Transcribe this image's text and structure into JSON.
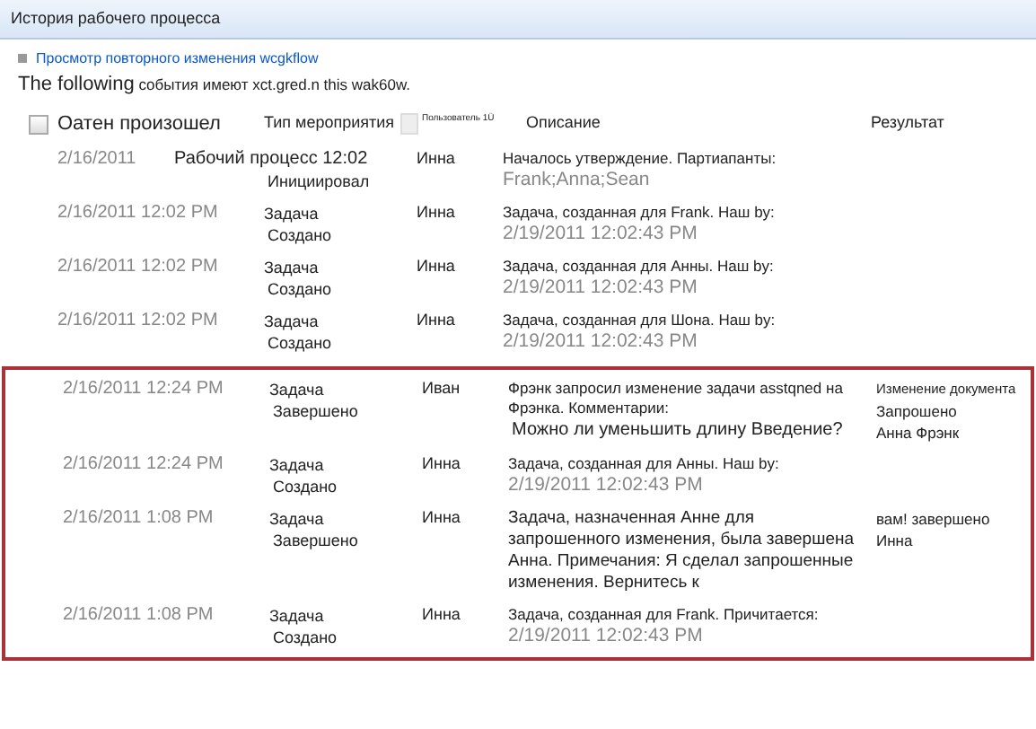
{
  "title": "История рабочего процесса",
  "view_link": "Просмотр повторного изменения wcgkflow",
  "intro": {
    "lead": "The following",
    "rest": "события имеют xct.gred.n this wak60w."
  },
  "columns": [
    {
      "label": "Оатен произошел",
      "kind": "date"
    },
    {
      "label": "Тип мероприятия",
      "kind": "type"
    },
    {
      "label": "Пользователь 1Ü",
      "kind": "user"
    },
    {
      "label": "Описание",
      "kind": "desc"
    },
    {
      "label": "Результат",
      "kind": "result"
    }
  ],
  "select_all": {
    "checked": false
  },
  "rows": [
    {
      "date": "2/16/2011",
      "type": [
        "Рабочий процесс 12:02",
        "Инициировал"
      ],
      "user": "Инна",
      "description": "Началось утверждение. Партиапанты:",
      "detail": "Frank;Anna;Sean",
      "result": []
    },
    {
      "date": "2/16/2011 12:02 PM",
      "type": [
        "Задача",
        "Создано"
      ],
      "user": "Инна",
      "description": "Задача, созданная для Frank. Наш by:",
      "detail": "2/19/2011 12:02:43 PM",
      "result": []
    },
    {
      "date": "2/16/2011 12:02 PM",
      "type": [
        "Задача",
        "Создано"
      ],
      "user": "Инна",
      "description": "Задача, созданная для Анны. Наш by:",
      "detail": "2/19/2011 12:02:43 PM",
      "result": []
    },
    {
      "date": "2/16/2011 12:02 PM",
      "type": [
        "Задача",
        "Создано"
      ],
      "user": "Инна",
      "description": "Задача, созданная для Шона. Наш by:",
      "detail": "2/19/2011 12:02:43 PM",
      "result": []
    }
  ],
  "highlighted_rows": [
    {
      "date": "2/16/2011 12:24 PM",
      "type": [
        "Задача",
        "Завершено"
      ],
      "user": "Иван",
      "description": "Фрэнк запросил изменение задачи asstqned на Фрэнка. Комментарии:",
      "comment": "Можно ли уменьшить длину Введение?",
      "result": [
        "Изменение документа",
        "Запрошено",
        "Анна Фрэнк"
      ]
    },
    {
      "date": "2/16/2011 12:24 PM",
      "type": [
        "Задача",
        "Создано"
      ],
      "user": "Инна",
      "description": "Задача, созданная для Анны. Наш by:",
      "detail": "2/19/2011 12:02:43 PM",
      "result": []
    },
    {
      "date": "2/16/2011 1:08 PM",
      "type": [
        "Задача",
        "Завершено"
      ],
      "user": "Инна",
      "description": "Задача, назначенная Анне для запрошенного изменения, была завершена Анна. Примечания:     Я сделал запрошенные изменения. Вернитесь к",
      "result": [
        "вам! завершено",
        "Инна"
      ]
    },
    {
      "date": "2/16/2011 1:08 PM",
      "type": [
        "Задача",
        "Создано"
      ],
      "user": "Инна",
      "description": "Задача, созданная для Frank. Причитается:",
      "detail": "2/19/2011 12:02:43 PM",
      "result": []
    }
  ]
}
